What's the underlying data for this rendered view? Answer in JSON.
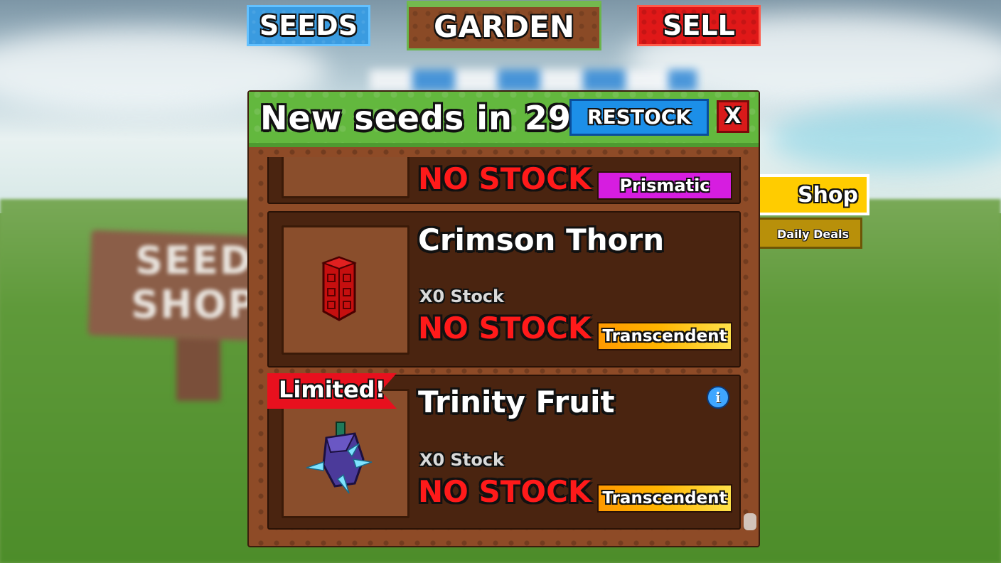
{
  "nav": {
    "seeds_label": "SEEDS",
    "garden_label": "GARDEN",
    "sell_label": "SELL"
  },
  "side": {
    "shop_label": "Shop",
    "daily_deals_label": "Daily Deals"
  },
  "background": {
    "sign_text": "SEED SHOP"
  },
  "shop_panel": {
    "title": "New seeds in 29s",
    "restock_label": "RESTOCK",
    "close_label": "X",
    "items": [
      {
        "name": "",
        "stock_text": "",
        "status": "NO STOCK",
        "rarity": "Prismatic",
        "limited_label": "",
        "icon": "seed-icon"
      },
      {
        "name": "Crimson Thorn",
        "stock_text": "X0 Stock",
        "status": "NO STOCK",
        "rarity": "Transcendent",
        "limited_label": "",
        "icon": "crimson-thorn-seed-icon"
      },
      {
        "name": "Trinity Fruit",
        "stock_text": "X0 Stock",
        "status": "NO STOCK",
        "rarity": "Transcendent",
        "limited_label": "Limited!",
        "icon": "trinity-fruit-seed-icon"
      }
    ]
  },
  "colors": {
    "seeds_button": "#3a9be0",
    "garden_button": "#8a4a26",
    "sell_button": "#e01818",
    "header_green": "#63b83e",
    "panel_brown": "#8e4b27",
    "no_stock_red": "#ff1a1a",
    "prismatic": "#d61de0",
    "transcendent": "#ffb400",
    "shop_yellow": "#ffcc00"
  }
}
